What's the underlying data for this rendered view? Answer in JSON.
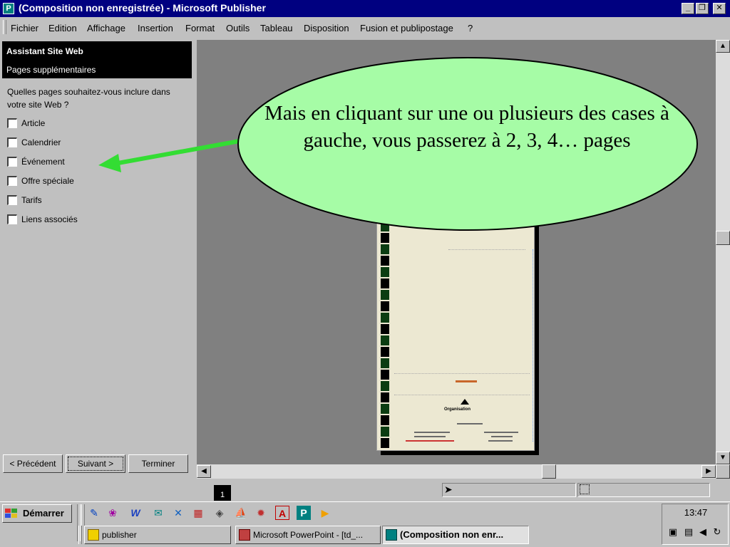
{
  "window": {
    "title": "(Composition non enregistrée) - Microsoft Publisher",
    "icon": "publisher-app-icon",
    "controls": [
      "minimize",
      "restore",
      "close"
    ]
  },
  "menubar": {
    "items": [
      "Fichier",
      "Edition",
      "Affichage",
      "Insertion",
      "Format",
      "Outils",
      "Tableau",
      "Disposition",
      "Fusion et publipostage",
      "?"
    ]
  },
  "wizard": {
    "title": "Assistant Site Web",
    "subtitle": "Pages supplémentaires",
    "question": "Quelles pages souhaitez-vous inclure dans votre site Web ?",
    "options": [
      {
        "label": "Article",
        "checked": false
      },
      {
        "label": "Calendrier",
        "checked": false
      },
      {
        "label": "Événement",
        "checked": false
      },
      {
        "label": "Offre spéciale",
        "checked": false
      },
      {
        "label": "Tarifs",
        "checked": false
      },
      {
        "label": "Liens associés",
        "checked": false
      }
    ],
    "buttons": {
      "back": "< Précédent",
      "next": "Suivant >",
      "finish": "Terminer"
    }
  },
  "callout": {
    "text": "Mais en cliquant sur une ou plusieurs des cases à gauche, vous passerez à 2, 3, 4… pages",
    "fill": "#a6fca6",
    "arrow_color": "#33dd33"
  },
  "page_preview": {
    "org_label": "Organisation"
  },
  "statusbar": {
    "page_number": "1"
  },
  "taskbar": {
    "start_label": "Démarrer",
    "quick_launch": [
      "paint-icon",
      "web-icon",
      "word-icon",
      "outlook-icon",
      "excel-icon",
      "control-icon",
      "network-icon",
      "sailboat-icon",
      "gear-icon",
      "acrobat-icon",
      "publisher-icon",
      "media-icon"
    ],
    "tasks": [
      {
        "label": "publisher",
        "icon": "folder-icon",
        "active": false
      },
      {
        "label": "Microsoft PowerPoint - [td_...",
        "icon": "powerpoint-icon",
        "active": false
      },
      {
        "label": "(Composition non enr...",
        "icon": "publisher-icon",
        "active": true
      }
    ],
    "clock": "13:47"
  },
  "colors": {
    "titlebar": "#000080",
    "workspace": "#808080",
    "page": "#ece8d2",
    "strip_dark": "#0b3d12"
  }
}
